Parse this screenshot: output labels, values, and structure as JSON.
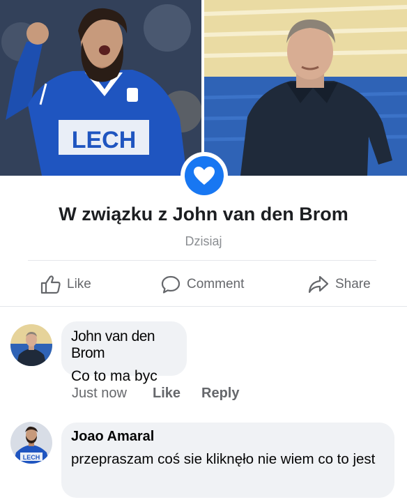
{
  "photos": {
    "left_jersey_text": "LECH"
  },
  "relationship": {
    "prefix": "W związku z",
    "name": "John van den Brom",
    "date": "Dzisiaj",
    "badge_icon": "heart-icon",
    "accent": "#1877f2"
  },
  "actions": [
    {
      "label": "Like",
      "icon": "thumbs-up-icon"
    },
    {
      "label": "Comment",
      "icon": "comment-icon"
    },
    {
      "label": "Share",
      "icon": "share-icon"
    }
  ],
  "comments": [
    {
      "author": "John van den Brom",
      "text": "Co to ma byc",
      "time": "Just now",
      "like": "Like",
      "reply": "Reply"
    },
    {
      "author": "Joao Amaral",
      "text": "przepraszam coś sie kliknęło nie wiem co to jest",
      "avatar_jersey_text": "LECH"
    }
  ]
}
